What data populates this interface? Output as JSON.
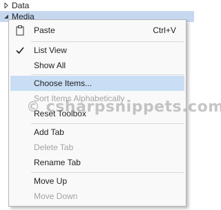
{
  "tree": {
    "items": [
      {
        "label": "Data",
        "expanded": false
      },
      {
        "label": "Media",
        "expanded": true
      }
    ]
  },
  "context_menu": {
    "paste": {
      "label": "Paste",
      "shortcut": "Ctrl+V",
      "icon": "clipboard-icon"
    },
    "list_view": {
      "label": "List View",
      "checked": true
    },
    "show_all": {
      "label": "Show All"
    },
    "choose_items": {
      "label": "Choose Items..."
    },
    "sort_items": {
      "label": "Sort Items Alphabetically",
      "disabled": true
    },
    "reset_toolbox": {
      "label": "Reset Toolbox"
    },
    "add_tab": {
      "label": "Add Tab"
    },
    "delete_tab": {
      "label": "Delete Tab",
      "disabled": true
    },
    "rename_tab": {
      "label": "Rename Tab"
    },
    "move_up": {
      "label": "Move Up"
    },
    "move_down": {
      "label": "Move Down",
      "disabled": true
    }
  },
  "watermark": {
    "symbol": "©",
    "text": "csharpsnippets.com"
  },
  "colors": {
    "menu_background": "#f9f9f9",
    "highlight": "#c9def5",
    "tree_selected": "#c6d8f0",
    "disabled_text": "#a3a3a3"
  }
}
